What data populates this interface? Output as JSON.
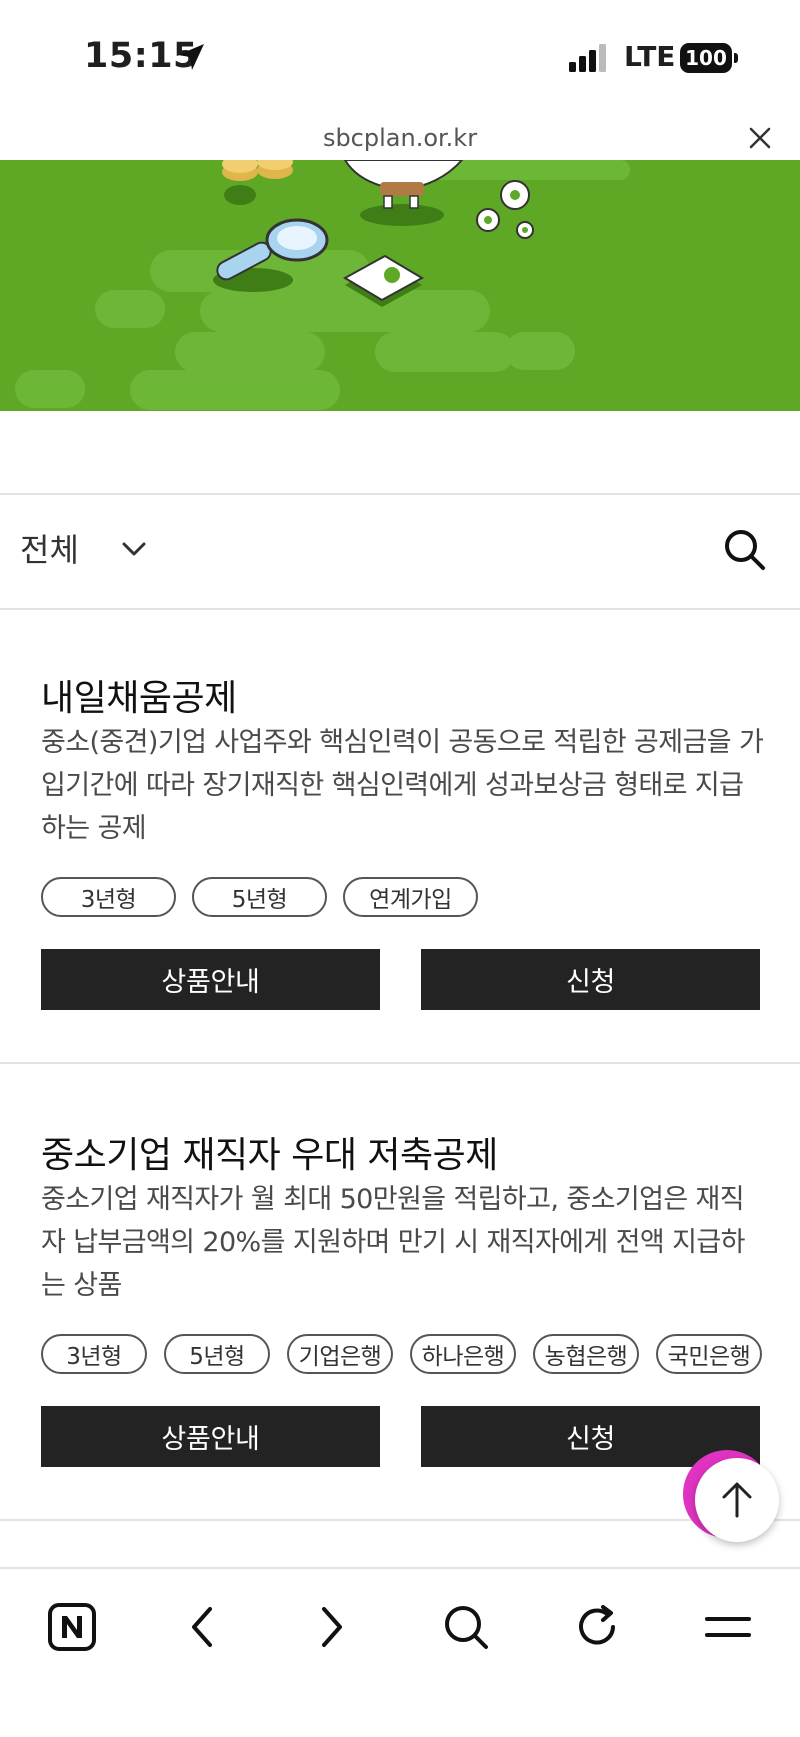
{
  "status_bar": {
    "time": "15:15",
    "network": "LTE",
    "battery": "100"
  },
  "browser": {
    "url": "sbcplan.or.kr"
  },
  "filter": {
    "selected": "전체"
  },
  "products": [
    {
      "title": "내일채움공제",
      "description": "중소(중견)기업 사업주와 핵심인력이 공동으로 적립한 공제금을 가입기간에 따라 장기재직한 핵심인력에게 성과보상금 형태로 지급하는 공제",
      "tags": [
        "3년형",
        "5년형",
        "연계가입"
      ],
      "info_button": "상품안내",
      "apply_button": "신청"
    },
    {
      "title": "중소기업 재직자 우대 저축공제",
      "description": "중소기업 재직자가 월 최대 50만원을 적립하고, 중소기업은 재직자 납부금액의 20%를 지원하며 만기 시 재직자에게 전액 지급하는 상품",
      "tags": [
        "3년형",
        "5년형",
        "기업은행",
        "하나은행",
        "농협은행",
        "국민은행"
      ],
      "info_button": "상품안내",
      "apply_button": "신청"
    }
  ],
  "colors": {
    "banner_green": "#5fa826",
    "button_dark": "#232323",
    "floating_accent": "#e033c2"
  },
  "toolbar_icons": [
    "naver-home-icon",
    "back-icon",
    "forward-icon",
    "search-icon",
    "refresh-icon",
    "menu-icon"
  ]
}
